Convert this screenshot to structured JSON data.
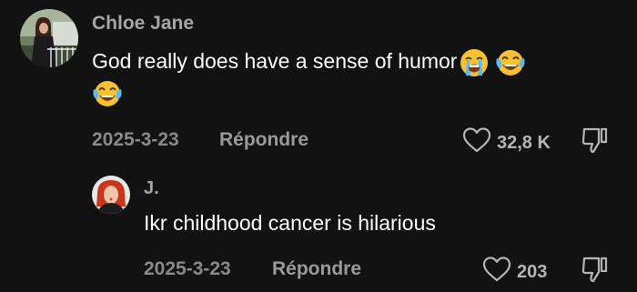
{
  "comments": [
    {
      "author": "Chloe Jane",
      "text_line1": "God really does have a sense of humor",
      "date": "2025-3-23",
      "reply_label": "Répondre",
      "likes": "32,8 K",
      "emojis": [
        "loudly-crying-face",
        "face-with-tears-of-joy",
        "face-with-tears-of-joy"
      ]
    },
    {
      "author": "J.",
      "text": "Ikr childhood cancer is hilarious",
      "date": "2025-3-23",
      "reply_label": "Répondre",
      "likes": "203"
    }
  ],
  "colors": {
    "background": "#121212",
    "author": "#a6a6a8",
    "body_text": "#ffffff",
    "meta": "#8a8a8c"
  },
  "icons": {
    "like": "heart-outline-icon",
    "dislike": "thumbs-down-outline-icon"
  }
}
